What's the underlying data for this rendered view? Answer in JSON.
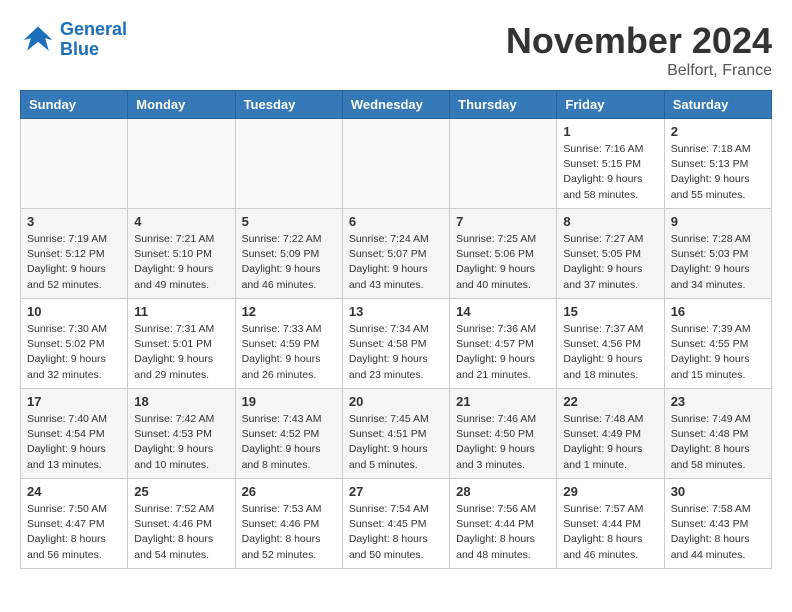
{
  "header": {
    "logo_line1": "General",
    "logo_line2": "Blue",
    "month": "November 2024",
    "location": "Belfort, France"
  },
  "weekdays": [
    "Sunday",
    "Monday",
    "Tuesday",
    "Wednesday",
    "Thursday",
    "Friday",
    "Saturday"
  ],
  "weeks": [
    [
      {
        "day": "",
        "info": ""
      },
      {
        "day": "",
        "info": ""
      },
      {
        "day": "",
        "info": ""
      },
      {
        "day": "",
        "info": ""
      },
      {
        "day": "",
        "info": ""
      },
      {
        "day": "1",
        "info": "Sunrise: 7:16 AM\nSunset: 5:15 PM\nDaylight: 9 hours and 58 minutes."
      },
      {
        "day": "2",
        "info": "Sunrise: 7:18 AM\nSunset: 5:13 PM\nDaylight: 9 hours and 55 minutes."
      }
    ],
    [
      {
        "day": "3",
        "info": "Sunrise: 7:19 AM\nSunset: 5:12 PM\nDaylight: 9 hours and 52 minutes."
      },
      {
        "day": "4",
        "info": "Sunrise: 7:21 AM\nSunset: 5:10 PM\nDaylight: 9 hours and 49 minutes."
      },
      {
        "day": "5",
        "info": "Sunrise: 7:22 AM\nSunset: 5:09 PM\nDaylight: 9 hours and 46 minutes."
      },
      {
        "day": "6",
        "info": "Sunrise: 7:24 AM\nSunset: 5:07 PM\nDaylight: 9 hours and 43 minutes."
      },
      {
        "day": "7",
        "info": "Sunrise: 7:25 AM\nSunset: 5:06 PM\nDaylight: 9 hours and 40 minutes."
      },
      {
        "day": "8",
        "info": "Sunrise: 7:27 AM\nSunset: 5:05 PM\nDaylight: 9 hours and 37 minutes."
      },
      {
        "day": "9",
        "info": "Sunrise: 7:28 AM\nSunset: 5:03 PM\nDaylight: 9 hours and 34 minutes."
      }
    ],
    [
      {
        "day": "10",
        "info": "Sunrise: 7:30 AM\nSunset: 5:02 PM\nDaylight: 9 hours and 32 minutes."
      },
      {
        "day": "11",
        "info": "Sunrise: 7:31 AM\nSunset: 5:01 PM\nDaylight: 9 hours and 29 minutes."
      },
      {
        "day": "12",
        "info": "Sunrise: 7:33 AM\nSunset: 4:59 PM\nDaylight: 9 hours and 26 minutes."
      },
      {
        "day": "13",
        "info": "Sunrise: 7:34 AM\nSunset: 4:58 PM\nDaylight: 9 hours and 23 minutes."
      },
      {
        "day": "14",
        "info": "Sunrise: 7:36 AM\nSunset: 4:57 PM\nDaylight: 9 hours and 21 minutes."
      },
      {
        "day": "15",
        "info": "Sunrise: 7:37 AM\nSunset: 4:56 PM\nDaylight: 9 hours and 18 minutes."
      },
      {
        "day": "16",
        "info": "Sunrise: 7:39 AM\nSunset: 4:55 PM\nDaylight: 9 hours and 15 minutes."
      }
    ],
    [
      {
        "day": "17",
        "info": "Sunrise: 7:40 AM\nSunset: 4:54 PM\nDaylight: 9 hours and 13 minutes."
      },
      {
        "day": "18",
        "info": "Sunrise: 7:42 AM\nSunset: 4:53 PM\nDaylight: 9 hours and 10 minutes."
      },
      {
        "day": "19",
        "info": "Sunrise: 7:43 AM\nSunset: 4:52 PM\nDaylight: 9 hours and 8 minutes."
      },
      {
        "day": "20",
        "info": "Sunrise: 7:45 AM\nSunset: 4:51 PM\nDaylight: 9 hours and 5 minutes."
      },
      {
        "day": "21",
        "info": "Sunrise: 7:46 AM\nSunset: 4:50 PM\nDaylight: 9 hours and 3 minutes."
      },
      {
        "day": "22",
        "info": "Sunrise: 7:48 AM\nSunset: 4:49 PM\nDaylight: 9 hours and 1 minute."
      },
      {
        "day": "23",
        "info": "Sunrise: 7:49 AM\nSunset: 4:48 PM\nDaylight: 8 hours and 58 minutes."
      }
    ],
    [
      {
        "day": "24",
        "info": "Sunrise: 7:50 AM\nSunset: 4:47 PM\nDaylight: 8 hours and 56 minutes."
      },
      {
        "day": "25",
        "info": "Sunrise: 7:52 AM\nSunset: 4:46 PM\nDaylight: 8 hours and 54 minutes."
      },
      {
        "day": "26",
        "info": "Sunrise: 7:53 AM\nSunset: 4:46 PM\nDaylight: 8 hours and 52 minutes."
      },
      {
        "day": "27",
        "info": "Sunrise: 7:54 AM\nSunset: 4:45 PM\nDaylight: 8 hours and 50 minutes."
      },
      {
        "day": "28",
        "info": "Sunrise: 7:56 AM\nSunset: 4:44 PM\nDaylight: 8 hours and 48 minutes."
      },
      {
        "day": "29",
        "info": "Sunrise: 7:57 AM\nSunset: 4:44 PM\nDaylight: 8 hours and 46 minutes."
      },
      {
        "day": "30",
        "info": "Sunrise: 7:58 AM\nSunset: 4:43 PM\nDaylight: 8 hours and 44 minutes."
      }
    ]
  ]
}
